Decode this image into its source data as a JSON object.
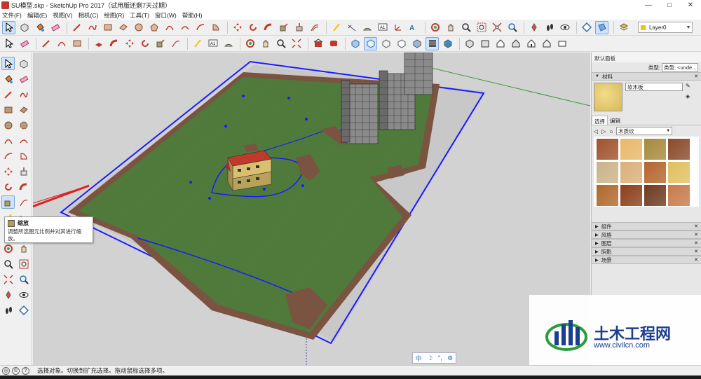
{
  "window": {
    "title": "SU模型.skp - SketchUp Pro 2017（试用版还剩7天过期）",
    "controls": [
      "—",
      "□",
      "✕"
    ]
  },
  "menus": [
    "文件(F)",
    "编辑(E)",
    "视图(V)",
    "相机(C)",
    "绘图(R)",
    "工具(T)",
    "窗口(W)",
    "帮助(H)"
  ],
  "toolbar": {
    "layer_label": "Layer0"
  },
  "tooltip": {
    "title": "缩放",
    "description": "调整所选图元比例并对其进行缩放。"
  },
  "right_panel": {
    "title": "默认面板",
    "type_label": "类型:",
    "type_value": "类型: <unde...",
    "materials_section": "材料",
    "material_name": "软木板",
    "tab_select": "选择",
    "tab_edit": "编辑",
    "library": "木质纹",
    "collapsed_sections": [
      "组件",
      "风格",
      "图层",
      "阴影",
      "场景"
    ],
    "swatch_colors": [
      "#a0522d",
      "#e8b86a",
      "#a68a3c",
      "#8b4a2b",
      "#c9b48a",
      "#d9b07a",
      "#b5652e",
      "#e0c060",
      "#b0682c",
      "#8b3f1c",
      "#6e3a1e",
      "#c87a4a"
    ]
  },
  "status": {
    "text": "选择对象。切换到扩充选择。拖动鼠标选择多项。"
  },
  "ime": {
    "items": [
      "中",
      "☽",
      "°,",
      "⚙"
    ]
  },
  "watermark": {
    "text": "土木工程网",
    "url": "www.civilcn.com"
  },
  "colors": {
    "accent": "#cfe3fa",
    "grass": "#4f7a3c",
    "path": "#7a5440",
    "selection": "#1a1aff"
  }
}
